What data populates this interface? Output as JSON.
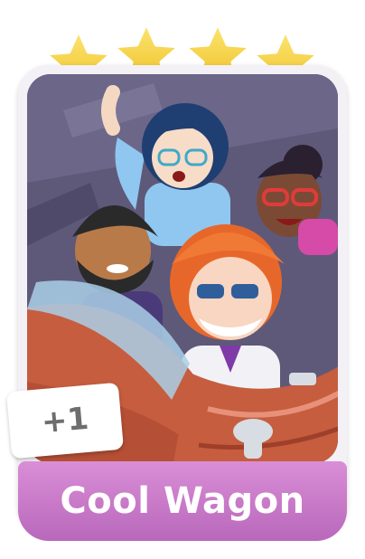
{
  "card": {
    "name": "Cool Wagon",
    "bonus_badge": "+1",
    "stars": {
      "filled": 4,
      "total": 4,
      "icon": "star-icon",
      "color": "#f5d13a"
    },
    "theme": {
      "banner_color": "#c978c8",
      "frame_color": "#f3f1f6"
    },
    "artwork": "cool-wagon-illustration"
  }
}
